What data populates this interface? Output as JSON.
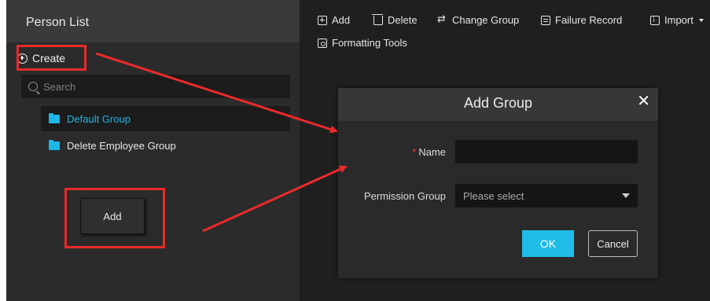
{
  "left": {
    "title": "Person List",
    "create_label": "Create",
    "search_placeholder": "Search",
    "groups": [
      {
        "label": "Default Group",
        "selected": true
      },
      {
        "label": "Delete Employee Group",
        "selected": false
      }
    ],
    "add_button_label": "Add"
  },
  "toolbar": {
    "add": "Add",
    "delete": "Delete",
    "change_group": "Change Group",
    "failure_record": "Failure Record",
    "import": "Import",
    "formatting_tools": "Formatting Tools"
  },
  "dialog": {
    "title": "Add Group",
    "close_glyph": "✕",
    "name_label": "Name",
    "required_mark": "*",
    "name_value": "",
    "permission_label": "Permission Group",
    "permission_placeholder": "Please select",
    "ok_label": "OK",
    "cancel_label": "Cancel"
  },
  "colors": {
    "accent": "#1fbde8",
    "annotation": "#ea2a2a",
    "panel_bg": "#2b2b2b",
    "dialog_bg": "#2a2a2a"
  },
  "icons": [
    "plus-circle-icon",
    "search-icon",
    "folder-icon",
    "add-icon",
    "trash-icon",
    "change-group-icon",
    "failure-record-icon",
    "import-icon",
    "formatting-tools-icon",
    "close-icon",
    "dropdown-caret-icon"
  ]
}
